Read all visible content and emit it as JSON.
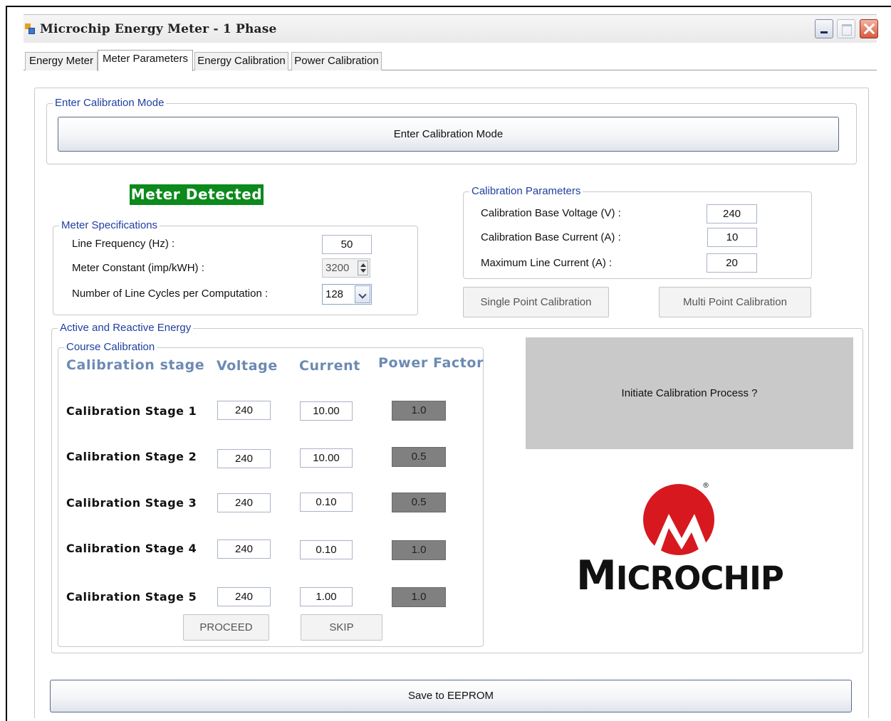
{
  "window": {
    "title": "Microchip Energy Meter - 1 Phase"
  },
  "tabs": [
    "Energy Meter",
    "Meter Parameters",
    "Energy Calibration",
    "Power Calibration"
  ],
  "active_tab": "Meter Parameters",
  "calibration_mode": {
    "group_title": "Enter Calibration Mode",
    "button_label": "Enter Calibration Mode"
  },
  "status": {
    "meter_detected": "Meter Detected",
    "color": "#0c8a1c"
  },
  "meter_specs": {
    "group_title": "Meter Specifications",
    "line_frequency_label": "Line Frequency (Hz)    :",
    "line_frequency_value": "50",
    "meter_constant_label": "Meter Constant (imp/kWH)    :",
    "meter_constant_value": "3200",
    "line_cycles_label": "Number of Line Cycles per Computation    :",
    "line_cycles_value": "128"
  },
  "calibration_params": {
    "group_title": "Calibration Parameters",
    "base_voltage_label": "Calibration Base Voltage  (V) :",
    "base_voltage_value": "240",
    "base_current_label": "Calibration Base Current  (A) :",
    "base_current_value": "10",
    "max_line_current_label": "Maximum Line Current (A)    :",
    "max_line_current_value": "20",
    "single_point_button": "Single Point Calibration",
    "multi_point_button": "Multi Point Calibration"
  },
  "energy": {
    "group_title": "Active and Reactive Energy",
    "course_title": "Course Calibration",
    "headers": {
      "stage": "Calibration stage",
      "voltage": "Voltage",
      "current": "Current",
      "power_factor": "Power Factor"
    },
    "stages": [
      {
        "label": "Calibration Stage 1",
        "voltage": "240",
        "current": "10.00",
        "pf": "1.0"
      },
      {
        "label": "Calibration Stage 2",
        "voltage": "240",
        "current": "10.00",
        "pf": "0.5"
      },
      {
        "label": "Calibration Stage 3",
        "voltage": "240",
        "current": "0.10",
        "pf": "0.5"
      },
      {
        "label": "Calibration Stage 4",
        "voltage": "240",
        "current": "0.10",
        "pf": "1.0"
      },
      {
        "label": "Calibration Stage 5",
        "voltage": "240",
        "current": "1.00",
        "pf": "1.0"
      }
    ],
    "proceed_button": "PROCEED",
    "skip_button": "SKIP"
  },
  "initiate_prompt": "Initiate Calibration Process ?",
  "logo": {
    "name": "MICROCHIP",
    "registered_mark": "®",
    "color": "#d7191f"
  },
  "save_button": "Save to EEPROM",
  "icons": [
    "app-icon",
    "minimize-icon",
    "maximize-icon",
    "close-icon",
    "spin-arrows-icon",
    "chevron-down-icon",
    "microchip-logo-icon"
  ]
}
